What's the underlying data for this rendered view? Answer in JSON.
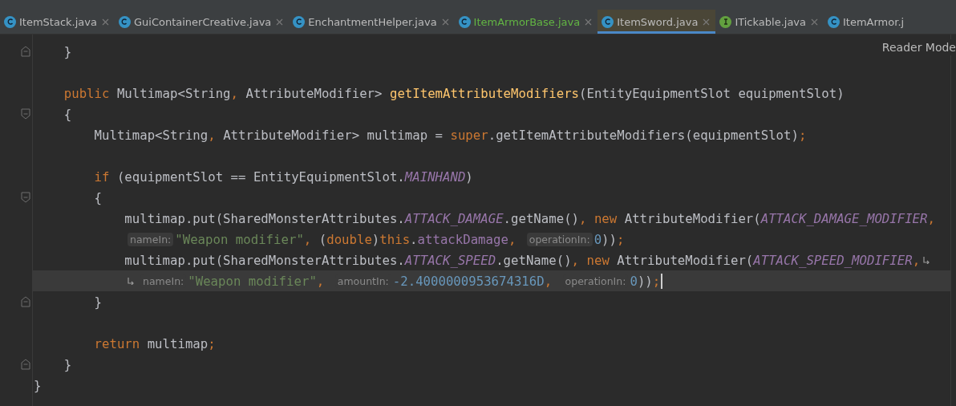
{
  "tabs": [
    {
      "label": "ItemStack.java",
      "kind": "class",
      "color": "#bbbbbb",
      "selected": false
    },
    {
      "label": "GuiContainerCreative.java",
      "kind": "class",
      "color": "#bbbbbb",
      "selected": false
    },
    {
      "label": "EnchantmentHelper.java",
      "kind": "class",
      "color": "#bbbbbb",
      "selected": false
    },
    {
      "label": "ItemArmorBase.java",
      "kind": "class",
      "color": "#62b543",
      "selected": false
    },
    {
      "label": "ItemSword.java",
      "kind": "class",
      "color": "#bbbbbb",
      "selected": true
    },
    {
      "label": "ITickable.java",
      "kind": "interface",
      "color": "#bbbbbb",
      "selected": false
    },
    {
      "label": "ItemArmor.j",
      "kind": "class",
      "color": "#bbbbbb",
      "selected": false
    }
  ],
  "reader_mode": "Reader Mode",
  "lines": [
    {
      "kind": "fold-end",
      "current": false,
      "tokens": [
        {
          "kind": "plain",
          "text": "    }"
        }
      ]
    },
    {
      "kind": "plain",
      "current": false
    },
    {
      "kind": "plain",
      "current": false,
      "tokens": [
        {
          "kind": "kw",
          "text": "    public"
        },
        {
          "kind": "plain",
          "text": " Multimap<String"
        },
        {
          "kind": "punct",
          "text": ","
        },
        {
          "kind": "plain",
          "text": " AttributeModifier> "
        },
        {
          "kind": "fn",
          "text": "getItemAttributeModifiers"
        },
        {
          "kind": "plain",
          "text": "(EntityEquipmentSlot equipmentSlot)"
        }
      ]
    },
    {
      "kind": "fold-start",
      "current": false,
      "tokens": [
        {
          "kind": "plain",
          "text": "    {"
        }
      ]
    },
    {
      "kind": "plain",
      "current": false,
      "tokens": [
        {
          "kind": "plain",
          "text": "        Multimap<String"
        },
        {
          "kind": "punct",
          "text": ","
        },
        {
          "kind": "plain",
          "text": " AttributeModifier> multimap = "
        },
        {
          "kind": "kw",
          "text": "super"
        },
        {
          "kind": "plain",
          "text": ".getItemAttributeModifiers(equipmentSlot)"
        },
        {
          "kind": "punct",
          "text": ";"
        }
      ]
    },
    {
      "kind": "plain",
      "current": false
    },
    {
      "kind": "plain",
      "current": false,
      "tokens": [
        {
          "kind": "kw",
          "text": "        if"
        },
        {
          "kind": "plain",
          "text": " (equipmentSlot == EntityEquipmentSlot."
        },
        {
          "kind": "const",
          "text": "MAINHAND"
        },
        {
          "kind": "plain",
          "text": ")"
        }
      ]
    },
    {
      "kind": "fold-start",
      "current": false,
      "tokens": [
        {
          "kind": "plain",
          "text": "        {"
        }
      ]
    },
    {
      "kind": "plain",
      "current": false,
      "tokens": [
        {
          "kind": "plain",
          "text": "            multimap.put(SharedMonsterAttributes."
        },
        {
          "kind": "const",
          "text": "ATTACK_DAMAGE"
        },
        {
          "kind": "plain",
          "text": ".getName()"
        },
        {
          "kind": "punct",
          "text": ","
        },
        {
          "kind": "kw",
          "text": " new"
        },
        {
          "kind": "plain",
          "text": " AttributeModifier("
        },
        {
          "kind": "const",
          "text": "ATTACK_DAMAGE_MODIFIER"
        },
        {
          "kind": "punct",
          "text": ","
        }
      ]
    },
    {
      "kind": "wrapped",
      "current": false,
      "tokens": [
        {
          "kind": "hint",
          "text": "nameIn:"
        },
        {
          "kind": "str",
          "text": "\"Weapon modifier\""
        },
        {
          "kind": "punct",
          "text": ", "
        },
        {
          "kind": "plain",
          "text": "("
        },
        {
          "kind": "kw",
          "text": "double"
        },
        {
          "kind": "plain",
          "text": ")"
        },
        {
          "kind": "kw",
          "text": "this"
        },
        {
          "kind": "plain",
          "text": "."
        },
        {
          "kind": "field",
          "text": "attackDamage"
        },
        {
          "kind": "punct",
          "text": ", "
        },
        {
          "kind": "hint",
          "text": "operationIn:"
        },
        {
          "kind": "num",
          "text": "0"
        },
        {
          "kind": "plain",
          "text": "))"
        },
        {
          "kind": "punct",
          "text": ";"
        }
      ]
    },
    {
      "kind": "plain",
      "current": false,
      "tokens": [
        {
          "kind": "plain",
          "text": "            multimap.put(SharedMonsterAttributes."
        },
        {
          "kind": "const",
          "text": "ATTACK_SPEED"
        },
        {
          "kind": "plain",
          "text": ".getName()"
        },
        {
          "kind": "punct",
          "text": ","
        },
        {
          "kind": "kw",
          "text": " new"
        },
        {
          "kind": "plain",
          "text": " AttributeModifier("
        },
        {
          "kind": "const",
          "text": "ATTACK_SPEED_MODIFIER"
        },
        {
          "kind": "punct",
          "text": ","
        },
        {
          "kind": "wrap"
        }
      ]
    },
    {
      "kind": "wrapped",
      "current": true,
      "tokens": [
        {
          "kind": "wrap"
        },
        {
          "kind": "hint",
          "text": "nameIn:"
        },
        {
          "kind": "str",
          "text": "\"Weapon modifier\""
        },
        {
          "kind": "punct",
          "text": ", "
        },
        {
          "kind": "hint",
          "text": "amountIn:"
        },
        {
          "kind": "num",
          "text": "-2.4000000953674316D"
        },
        {
          "kind": "punct",
          "text": ", "
        },
        {
          "kind": "hint",
          "text": "operationIn:"
        },
        {
          "kind": "num",
          "text": "0"
        },
        {
          "kind": "plain",
          "text": "))"
        },
        {
          "kind": "punct",
          "text": ";"
        },
        {
          "kind": "caret"
        }
      ]
    },
    {
      "kind": "fold-end",
      "current": false,
      "tokens": [
        {
          "kind": "plain",
          "text": "        }"
        }
      ]
    },
    {
      "kind": "plain",
      "current": false
    },
    {
      "kind": "plain",
      "current": false,
      "tokens": [
        {
          "kind": "kw",
          "text": "        return"
        },
        {
          "kind": "plain",
          "text": " multimap"
        },
        {
          "kind": "punct",
          "text": ";"
        }
      ]
    },
    {
      "kind": "fold-end",
      "current": false,
      "tokens": [
        {
          "kind": "plain",
          "text": "    }"
        }
      ]
    },
    {
      "kind": "plain",
      "current": false,
      "tokens": [
        {
          "kind": "plain",
          "text": "}"
        }
      ]
    }
  ]
}
